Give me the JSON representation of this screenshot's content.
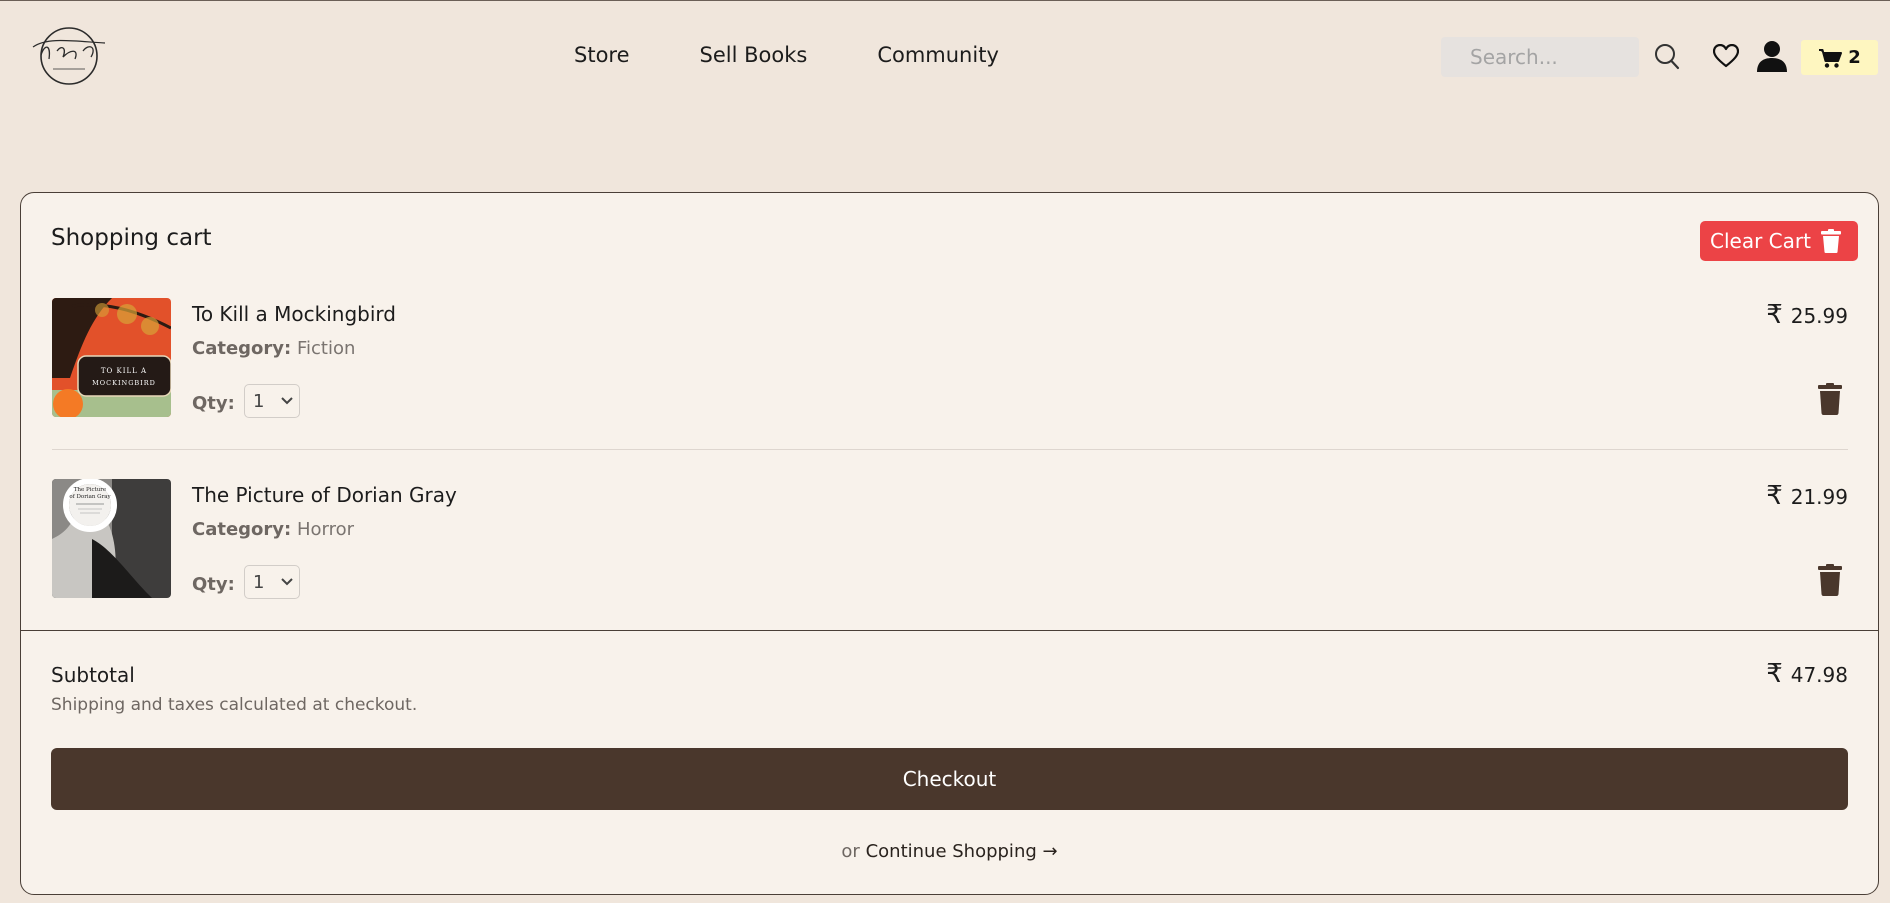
{
  "brand": {
    "logo_icon": "bookstop-logo"
  },
  "nav": {
    "items": [
      {
        "label": "Store"
      },
      {
        "label": "Sell Books"
      },
      {
        "label": "Community"
      }
    ]
  },
  "search": {
    "placeholder": "Search...",
    "icon": "search-icon"
  },
  "header_icons": [
    "heart-icon",
    "user-icon",
    "cart-icon"
  ],
  "cart_badge": {
    "count": "2",
    "background": "#fef6c0"
  },
  "cart": {
    "title": "Shopping cart",
    "clear_label": "Clear Cart",
    "clear_color": "#ec4346",
    "currency_symbol": "₹",
    "items": [
      {
        "name": "To Kill a Mockingbird",
        "category_label": "Category:",
        "category": "Fiction",
        "qty_label": "Qty:",
        "qty": "1",
        "price": "25.99",
        "cover_text": "TO KILL A MOCKINGBIRD"
      },
      {
        "name": "The Picture of Dorian Gray",
        "category_label": "Category:",
        "category": "Horror",
        "qty_label": "Qty:",
        "qty": "1",
        "price": "21.99",
        "cover_text": "The Picture of Dorian Gray"
      }
    ],
    "subtotal_label": "Subtotal",
    "subtotal": "47.98",
    "shipping_note": "Shipping and taxes calculated at checkout.",
    "checkout_label": "Checkout",
    "checkout_color": "#4a372c",
    "continue_prefix": "or",
    "continue_label": "Continue Shopping →"
  }
}
